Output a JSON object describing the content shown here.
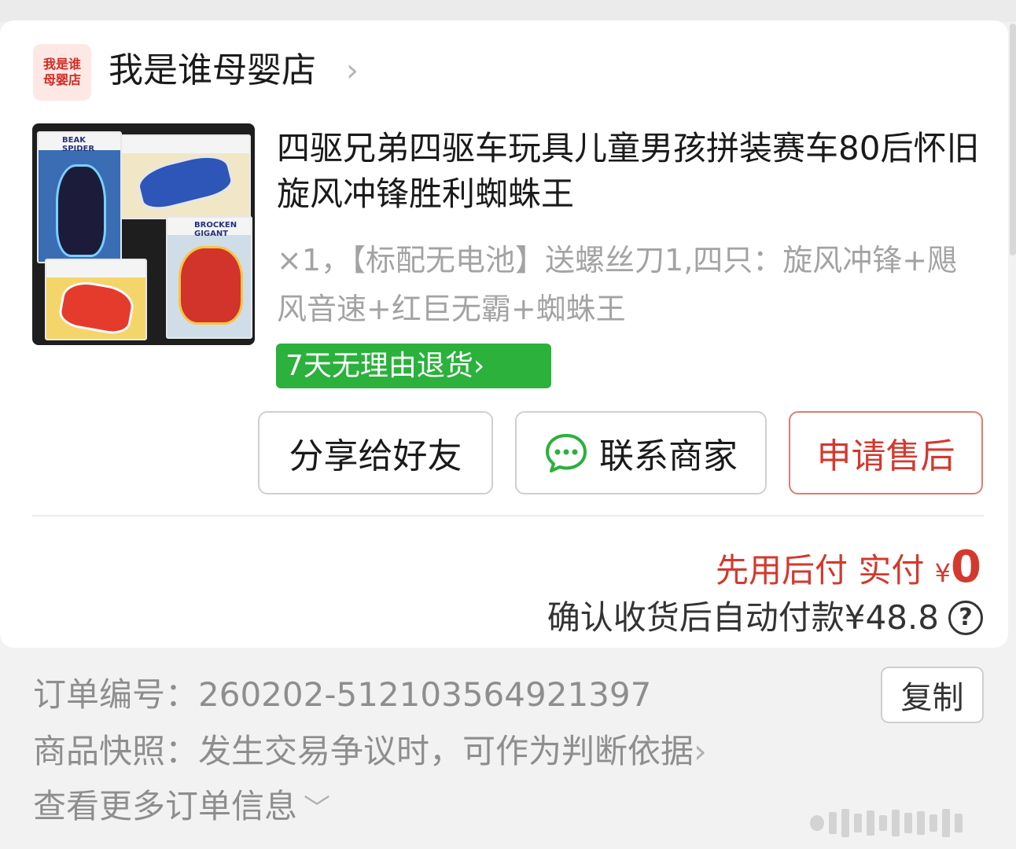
{
  "shop": {
    "logo_line1": "我是谁",
    "logo_line2": "母婴店",
    "name": "我是谁母婴店",
    "chevron": "›"
  },
  "product": {
    "image_box_labels": [
      "BEAK SPIDER",
      "BROCKEN GIGANT"
    ],
    "title": "四驱兄弟四驱车玩具儿童男孩拼装赛车80后怀旧旋风冲锋胜利蜘蛛王",
    "spec": "×1，【标配无电池】送螺丝刀1,四只：旋风冲锋+飓风音速+红巨无霸+蜘蛛王",
    "return_badge": "7天无理由退货›"
  },
  "buttons": {
    "share": "分享给好友",
    "contact": "联系商家",
    "after_sale": "申请售后"
  },
  "payment": {
    "label": "先用后付 实付 ",
    "currency": "¥",
    "amount": "0",
    "auto_pay": "确认收货后自动付款¥48.8",
    "help_icon": "?"
  },
  "order_info": {
    "order_no_label": "订单编号：",
    "order_no": "260202-512103564921397",
    "copy_label": "复制",
    "snapshot_label": "商品快照：",
    "snapshot_text": "发生交易争议时，可作为判断依据",
    "snapshot_chevron": "›",
    "more_info": "查看更多订单信息",
    "more_chevron": "﹀"
  },
  "colors": {
    "accent_red": "#d3392e",
    "badge_green": "#2bb13c",
    "muted_gray": "#8e8e8e"
  },
  "icons": [
    "shop-logo",
    "chevron-right-icon",
    "chat-bubble-icon",
    "help-circle-icon",
    "chevron-down-icon"
  ]
}
